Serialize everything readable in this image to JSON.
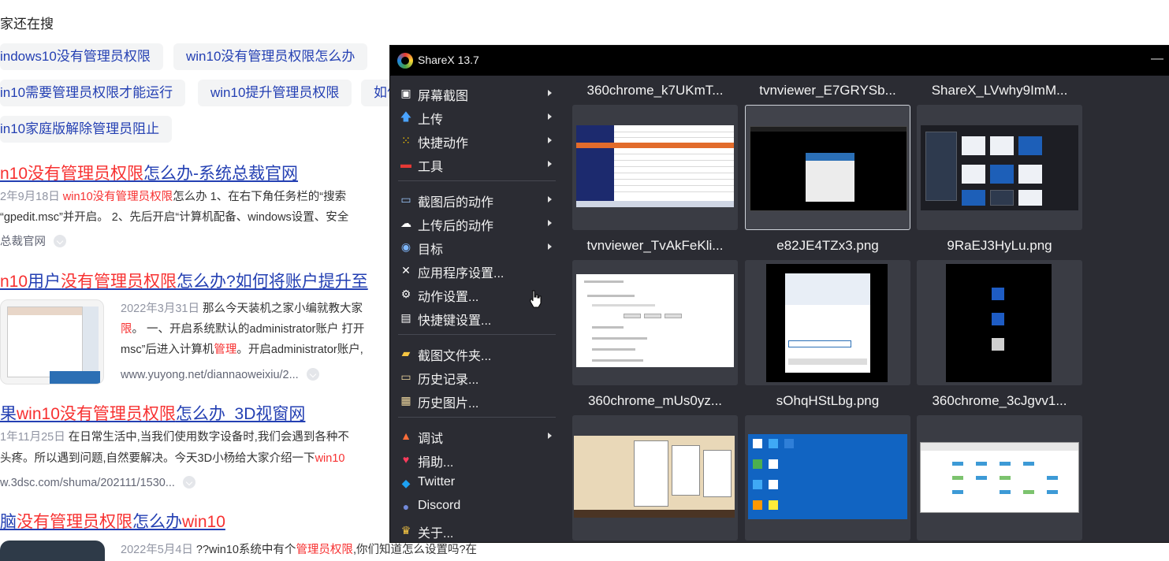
{
  "search_page": {
    "others_searching": "家还在搜",
    "related_chips": [
      "indows10没有管理员权限",
      "win10没有管理员权限怎么办",
      "in10需要管理员权限才能运行",
      "win10提升管理员权限",
      "如何",
      "in10家庭版解除管理员阻止"
    ],
    "results": [
      {
        "title_parts": [
          "n10没有管理员权限",
          "怎么办-系统总裁官网"
        ],
        "date": "2年9月18日",
        "snippet_parts": [
          "win10没有管理员权限",
          "怎么办 1、在右下角任务栏的“搜索"
        ],
        "snippet2": "“gpedit.msc”并开启。 2、先后开启“计算机配备、windows设置、安全",
        "source": "总裁官网"
      },
      {
        "title_parts": [
          "n10",
          "用户",
          "没有管理员权限",
          "怎么办?如何将账户提升至"
        ],
        "date": "2022年3月31日",
        "snippet_parts": [
          "那么今天装机之家小编就教大家"
        ],
        "snippet2_parts": [
          "限",
          "。 一、开启系统默认的administrator账户 打开"
        ],
        "snippet3_parts": [
          "msc”后进入计算机",
          "管理",
          "。开启administrator账户,"
        ],
        "source": "www.yuyong.net/diannaoweixiu/2..."
      },
      {
        "title_parts": [
          "果",
          "win10没有管理员权限",
          "怎么办_3D视窗网"
        ],
        "date": "1年11月25日",
        "snippet_parts": [
          "在日常生活中,当我们使用数字设备时,我们会遇到各种不"
        ],
        "snippet2_parts": [
          "头疼。所以遇到问题,自然要解决。今天3D小杨给大家介绍一下",
          "win10"
        ],
        "source": "w.3dsc.com/shuma/202111/1530..."
      },
      {
        "title_parts": [
          "脑",
          "没有管理员权限",
          "怎么办",
          "win10"
        ],
        "date": "2022年5月4日",
        "snippet_parts": [
          "??win10系统中有个",
          "管理员权限",
          ",你们知道怎么设置吗?在"
        ]
      }
    ]
  },
  "sharex": {
    "title": "ShareX 13.7",
    "menu": [
      {
        "label": "屏幕截图",
        "icon": "screenshot-icon",
        "submenu": true
      },
      {
        "label": "上传",
        "icon": "upload-icon",
        "submenu": true
      },
      {
        "label": "快捷动作",
        "icon": "quick-actions-icon",
        "submenu": true
      },
      {
        "label": "工具",
        "icon": "tools-icon",
        "submenu": true
      },
      {
        "label": "截图后的动作",
        "icon": "after-capture-icon",
        "submenu": true
      },
      {
        "label": "上传后的动作",
        "icon": "after-upload-icon",
        "submenu": true
      },
      {
        "label": "目标",
        "icon": "destinations-icon",
        "submenu": true
      },
      {
        "label": "应用程序设置...",
        "icon": "app-settings-icon",
        "submenu": false
      },
      {
        "label": "动作设置...",
        "icon": "task-settings-icon",
        "submenu": false
      },
      {
        "label": "快捷键设置...",
        "icon": "hotkey-settings-icon",
        "submenu": false
      },
      {
        "label": "截图文件夹...",
        "icon": "screenshots-folder-icon",
        "submenu": false
      },
      {
        "label": "历史记录...",
        "icon": "history-icon",
        "submenu": false
      },
      {
        "label": "历史图片...",
        "icon": "image-history-icon",
        "submenu": false
      },
      {
        "label": "调试",
        "icon": "debug-icon",
        "submenu": true
      },
      {
        "label": "捐助...",
        "icon": "donate-heart-icon",
        "submenu": false
      },
      {
        "label": "Twitter",
        "icon": "twitter-icon",
        "submenu": false
      },
      {
        "label": "Discord",
        "icon": "discord-icon",
        "submenu": false
      },
      {
        "label": "关于...",
        "icon": "about-crown-icon",
        "submenu": false
      }
    ],
    "thumbnails": [
      "360chrome_k7UKmT...",
      "tvnviewer_E7GRYSb...",
      "ShareX_LVwhy9ImM...",
      "tvnviewer_TvAkFeKli...",
      "e82JE4TZx3.png",
      "9RaEJ3HyLu.png",
      "360chrome_mUs0yz...",
      "sOhqHStLbg.png",
      "360chrome_3cJgvv1..."
    ],
    "selected_thumbnail": "tvnviewer_E7GRYSb..."
  }
}
